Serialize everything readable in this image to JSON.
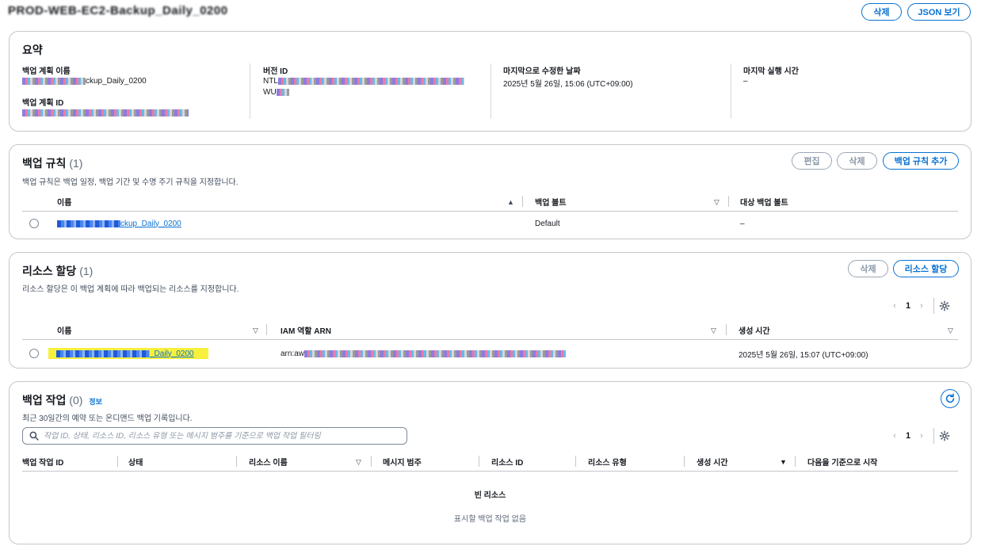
{
  "header": {
    "title": "PROD-WEB-EC2-Backup_Daily_0200",
    "delete_label": "삭제",
    "json_label": "JSON 보기"
  },
  "summary": {
    "title": "요약",
    "plan_name_label": "백업 계획 이름",
    "plan_name_value": "ckup_Daily_0200",
    "plan_id_label": "백업 계획 ID",
    "version_label": "버전 ID",
    "version_prefix_1": "NTL",
    "version_prefix_2": "WU",
    "modified_label": "마지막으로 수정한 날짜",
    "modified_value": "2025년 5월 26일, 15:06 (UTC+09:00)",
    "last_run_label": "마지막 실행 시간",
    "last_run_value": "–"
  },
  "rules": {
    "title": "백업 규칙",
    "count": "(1)",
    "description": "백업 규칙은 백업 일정, 백업 기간 및 수명 주기 규칙을 지정합니다.",
    "edit_label": "편집",
    "delete_label": "삭제",
    "add_label": "백업 규칙 추가",
    "columns": [
      "이름",
      "백업 볼트",
      "대상 백업 볼트"
    ],
    "rows": [
      {
        "name": "ckup_Daily_0200",
        "vault": "Default",
        "target": "–"
      }
    ]
  },
  "assignments": {
    "title": "리소스 할당",
    "count": "(1)",
    "description": "리소스 할당은 이 백업 계획에 따라 백업되는 리소스를 지정합니다.",
    "delete_label": "삭제",
    "assign_label": "리소스 할당",
    "page": "1",
    "columns": [
      "이름",
      "IAM 역할 ARN",
      "생성 시간"
    ],
    "rows": [
      {
        "name": "_Daily_0200",
        "arn": "arn:aw",
        "created": "2025년 5월 26일, 15:07 (UTC+09:00)"
      }
    ]
  },
  "jobs": {
    "title": "백업 작업",
    "count": "(0)",
    "info_label": "정보",
    "description": "최근 30일간의 예약 또는 온디맨드 백업 기록입니다.",
    "search_placeholder": "작업 ID, 상태, 리소스 ID, 리소스 유형 또는 메시지 범주를 기준으로 백업 작업 필터링",
    "page": "1",
    "columns": [
      "백업 작업 ID",
      "상태",
      "리소스 이름",
      "메시지 범주",
      "리소스 ID",
      "리소스 유형",
      "생성 시간",
      "다음을 기준으로 시작"
    ],
    "empty_title": "빈 리소스",
    "empty_desc": "표시할 백업 작업 없음"
  },
  "colors": {
    "accent": "#0972d3",
    "border": "#c6c6cd",
    "highlight": "#f7f03c"
  }
}
